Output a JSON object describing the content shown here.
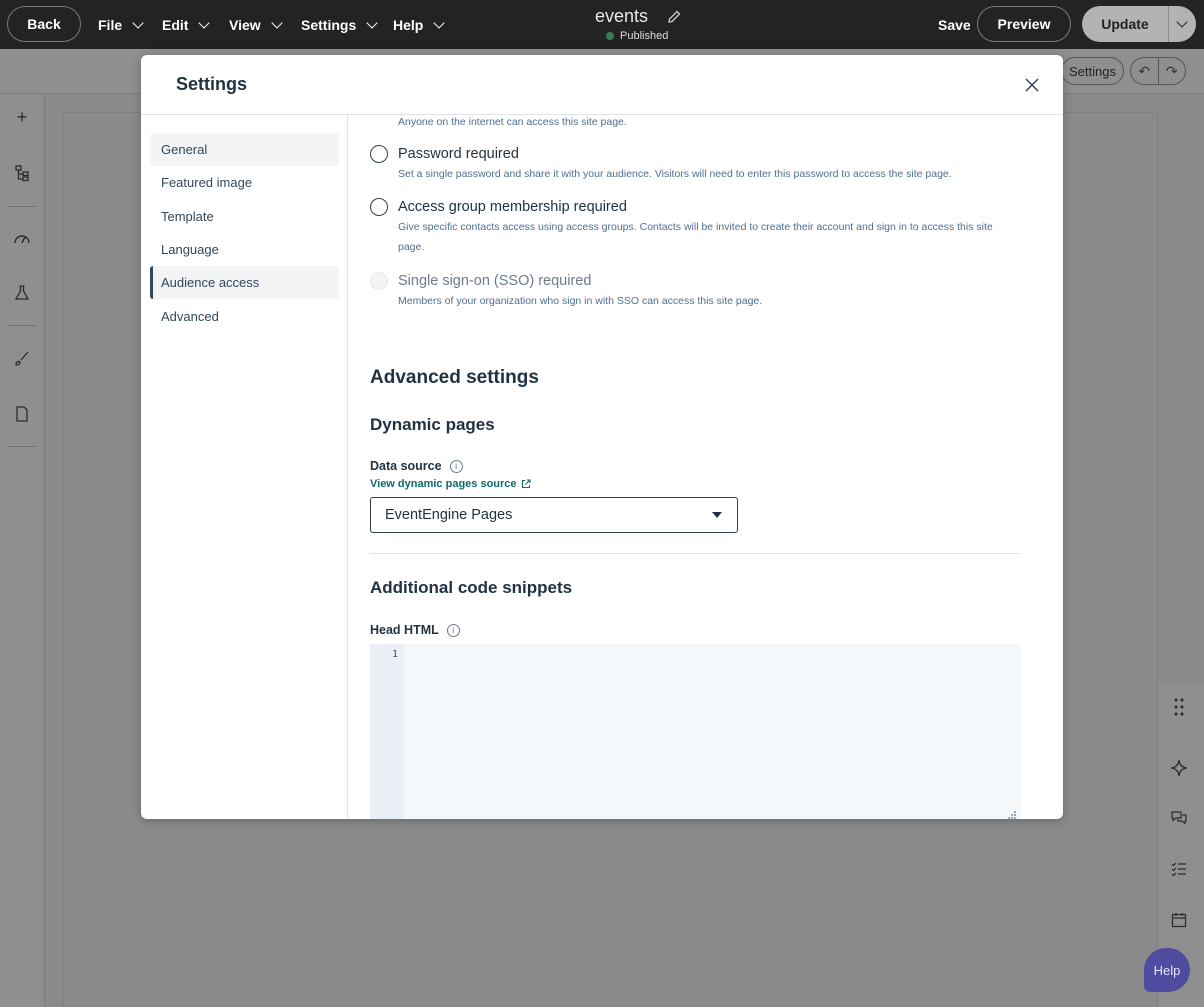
{
  "topbar": {
    "back_label": "Back",
    "menus": [
      {
        "label": "File"
      },
      {
        "label": "Edit"
      },
      {
        "label": "View"
      },
      {
        "label": "Settings"
      },
      {
        "label": "Help"
      }
    ],
    "page_title": "events",
    "status": "Published",
    "save_label": "Save",
    "preview_label": "Preview",
    "update_label": "Update"
  },
  "subbar": {
    "settings_label": "Settings"
  },
  "help_fab_label": "Help",
  "modal": {
    "title": "Settings",
    "nav": [
      {
        "label": "General"
      },
      {
        "label": "Featured image"
      },
      {
        "label": "Template"
      },
      {
        "label": "Language"
      },
      {
        "label": "Audience access"
      },
      {
        "label": "Advanced"
      }
    ],
    "audience": {
      "public_desc": "Anyone on the internet can access this site page.",
      "options": [
        {
          "label": "Password required",
          "desc": "Set a single password and share it with your audience. Visitors will need to enter this password to access the site page."
        },
        {
          "label": "Access group membership required",
          "desc": "Give specific contacts access using access groups. Contacts will be invited to create their account and sign in to access this site page."
        },
        {
          "label": "Single sign-on (SSO) required",
          "desc": "Members of your organization who sign in with SSO can access this site page."
        }
      ]
    },
    "advanced": {
      "heading": "Advanced settings",
      "dynamic_heading": "Dynamic pages",
      "data_source_label": "Data source",
      "data_source_link": "View dynamic pages source",
      "data_source_value": "EventEngine Pages",
      "snippets_heading": "Additional code snippets",
      "head_html_label": "Head HTML",
      "line_number": "1"
    }
  },
  "colors": {
    "topbar_bg": "#232323",
    "link": "#0b6b6b",
    "help_fab": "#4f4ba0",
    "status_dot": "#3c7b5c"
  }
}
